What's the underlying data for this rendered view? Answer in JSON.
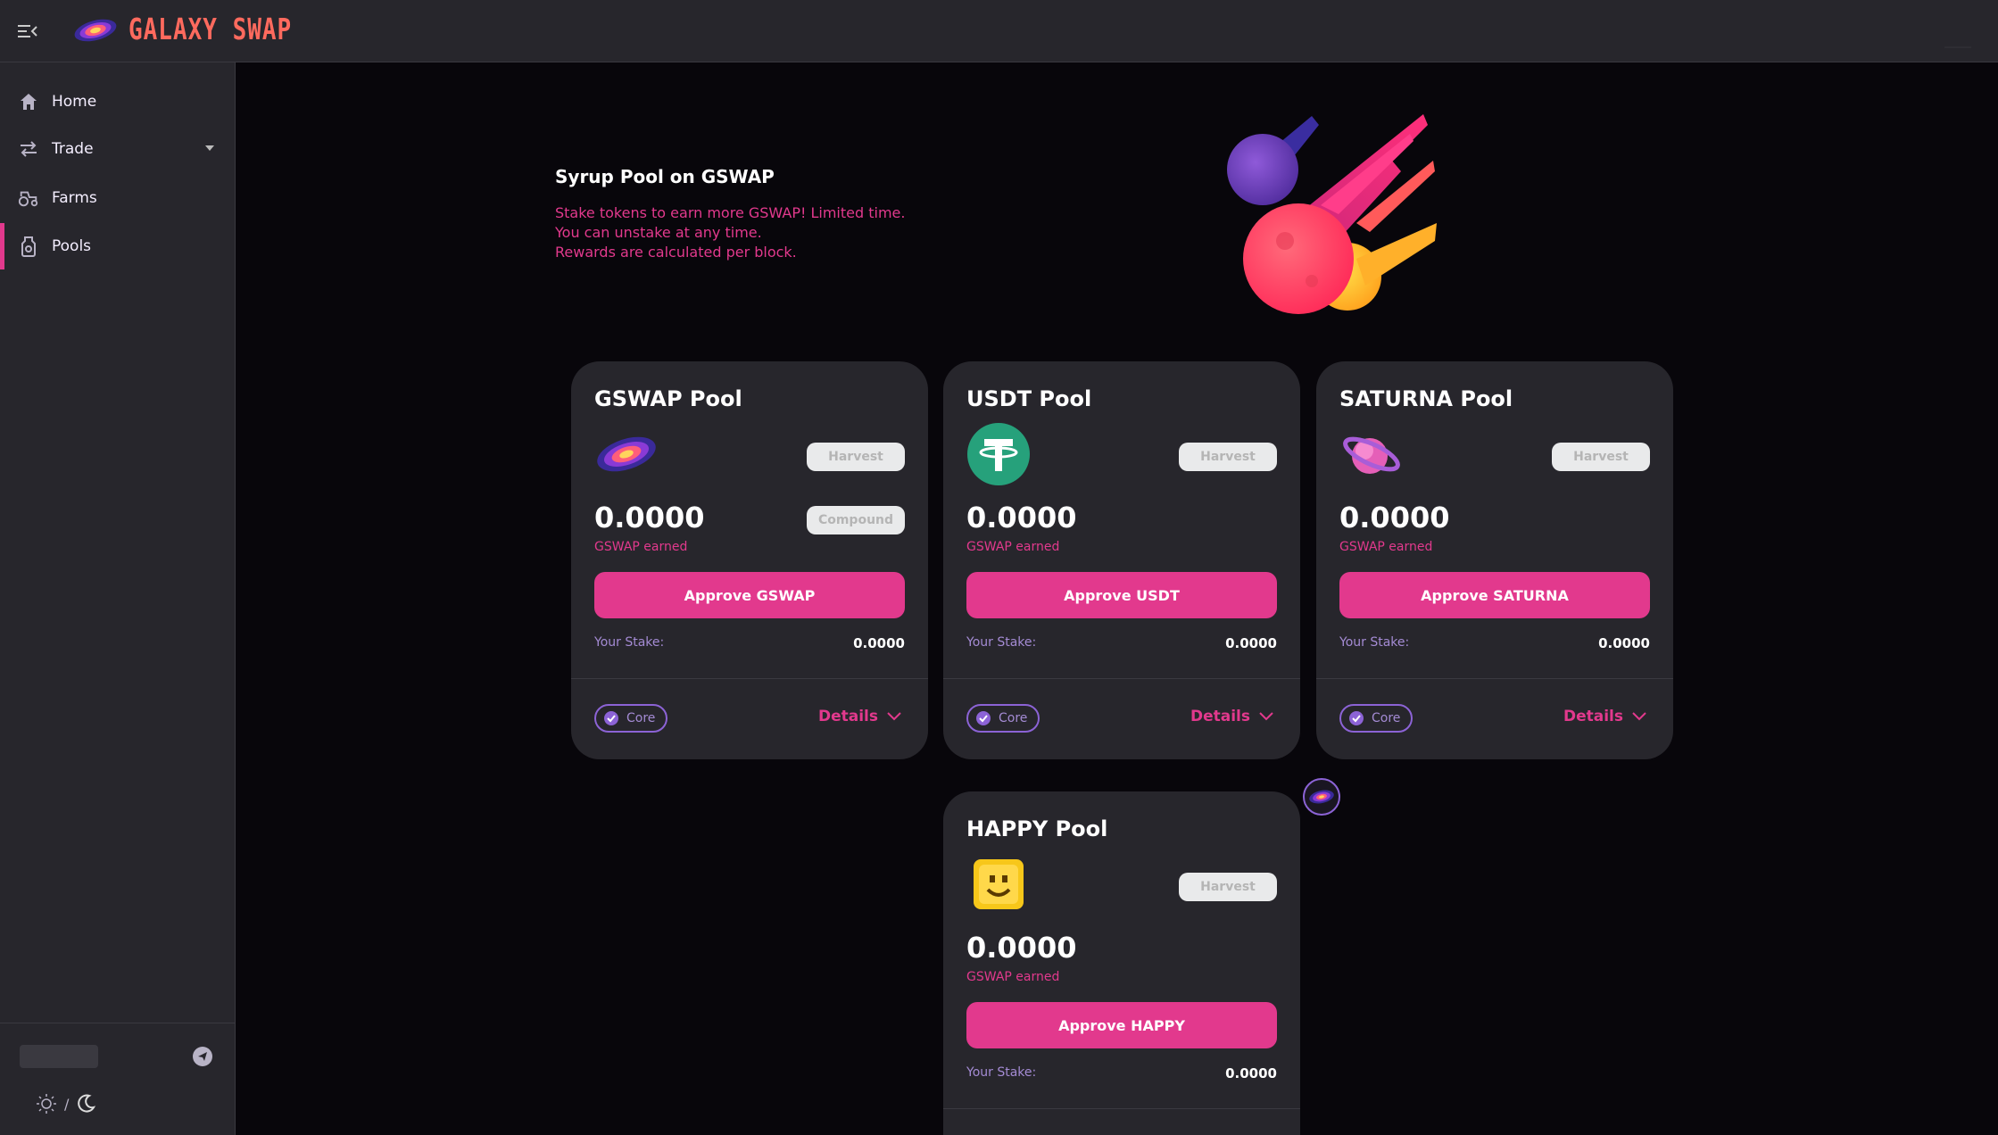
{
  "header": {
    "logo_text": "GALAXY SWAP"
  },
  "sidebar": {
    "items": [
      {
        "label": "Home",
        "icon": "home-icon"
      },
      {
        "label": "Trade",
        "icon": "swap-icon"
      },
      {
        "label": "Farms",
        "icon": "tractor-icon"
      },
      {
        "label": "Pools",
        "icon": "pool-icon"
      }
    ],
    "active": "Pools",
    "theme_separator": "/"
  },
  "hero": {
    "title": "Syrup Pool on GSWAP",
    "lines": [
      "Stake tokens to earn more GSWAP! Limited time.",
      "You can unstake at any time.",
      "Rewards are calculated per block."
    ]
  },
  "pools": [
    {
      "title": "GSWAP Pool",
      "harvest": "Harvest",
      "compound": "Compound",
      "earned": "0.0000",
      "earned_label": "GSWAP earned",
      "approve": "Approve GSWAP",
      "stake_label": "Your Stake:",
      "stake_value": "0.0000",
      "badge": "Core",
      "details": "Details"
    },
    {
      "title": "USDT Pool",
      "harvest": "Harvest",
      "earned": "0.0000",
      "earned_label": "GSWAP earned",
      "approve": "Approve USDT",
      "stake_label": "Your Stake:",
      "stake_value": "0.0000",
      "badge": "Core",
      "details": "Details"
    },
    {
      "title": "SATURNA Pool",
      "harvest": "Harvest",
      "earned": "0.0000",
      "earned_label": "GSWAP earned",
      "approve": "Approve SATURNA",
      "stake_label": "Your Stake:",
      "stake_value": "0.0000",
      "badge": "Core",
      "details": "Details"
    },
    {
      "title": "HAPPY Pool",
      "harvest": "Harvest",
      "earned": "0.0000",
      "earned_label": "GSWAP earned",
      "approve": "Approve HAPPY",
      "stake_label": "Your Stake:",
      "stake_value": "0.0000"
    }
  ],
  "colors": {
    "accent": "#e2398d",
    "purple": "#8c63d6",
    "card": "#27262c",
    "background": "#08060b"
  }
}
